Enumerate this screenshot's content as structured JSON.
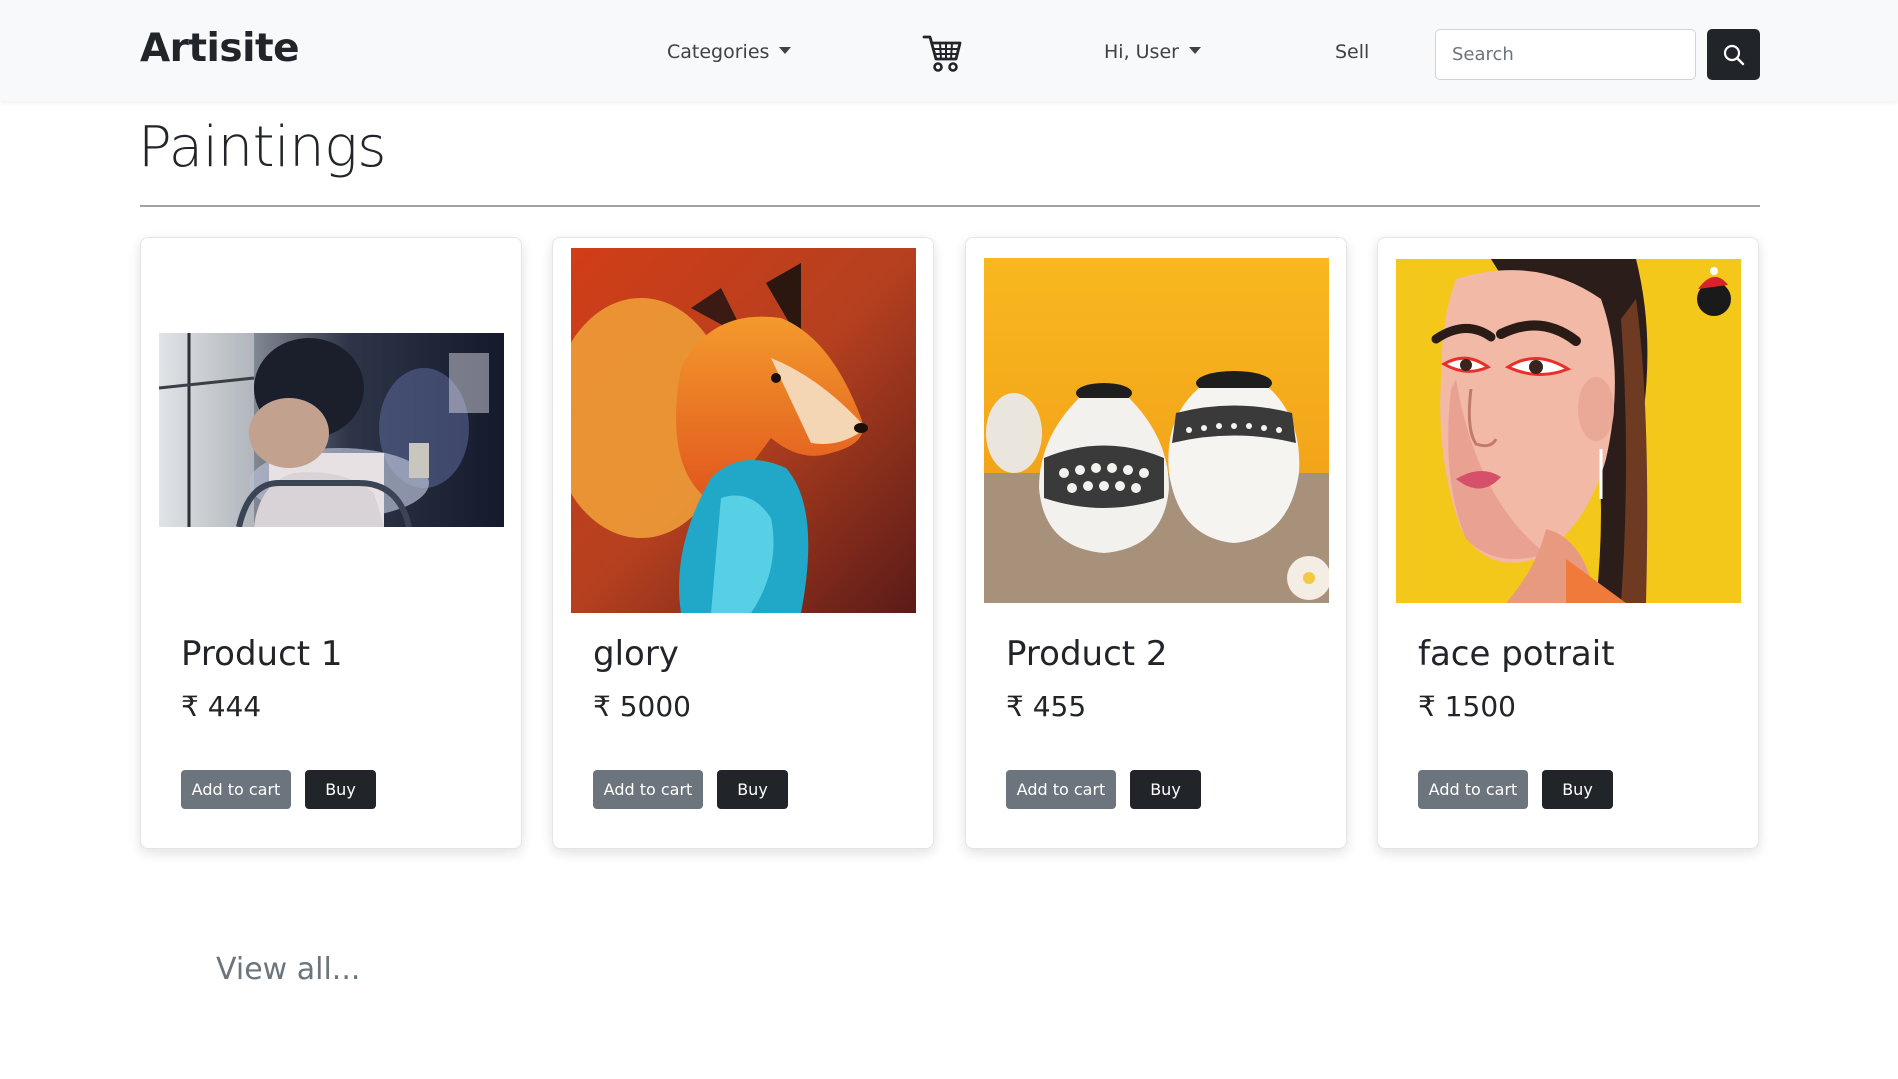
{
  "navbar": {
    "brand": "Artisite",
    "categories_label": "Categories",
    "user_label": "Hi, User",
    "sell_label": "Sell",
    "search_placeholder": "Search",
    "search_icon": "search-icon",
    "cart_icon": "cart-icon"
  },
  "page": {
    "title": "Paintings",
    "view_all": "View all..."
  },
  "products": [
    {
      "title": "Product 1",
      "price": "₹ 444",
      "add_to_cart": "Add to cart",
      "buy": "Buy",
      "image": "woman-on-bus-watercolor"
    },
    {
      "title": "glory",
      "price": "₹ 5000",
      "add_to_cart": "Add to cart",
      "buy": "Buy",
      "image": "fox-painting"
    },
    {
      "title": "Product 2",
      "price": "₹ 455",
      "add_to_cart": "Add to cart",
      "buy": "Buy",
      "image": "painted-pots"
    },
    {
      "title": "face potrait",
      "price": "₹ 1500",
      "add_to_cart": "Add to cart",
      "buy": "Buy",
      "image": "woman-face-portrait"
    }
  ],
  "colors": {
    "navbar_bg": "#f8f9fa",
    "dark": "#212529",
    "secondary": "#6c757d"
  }
}
